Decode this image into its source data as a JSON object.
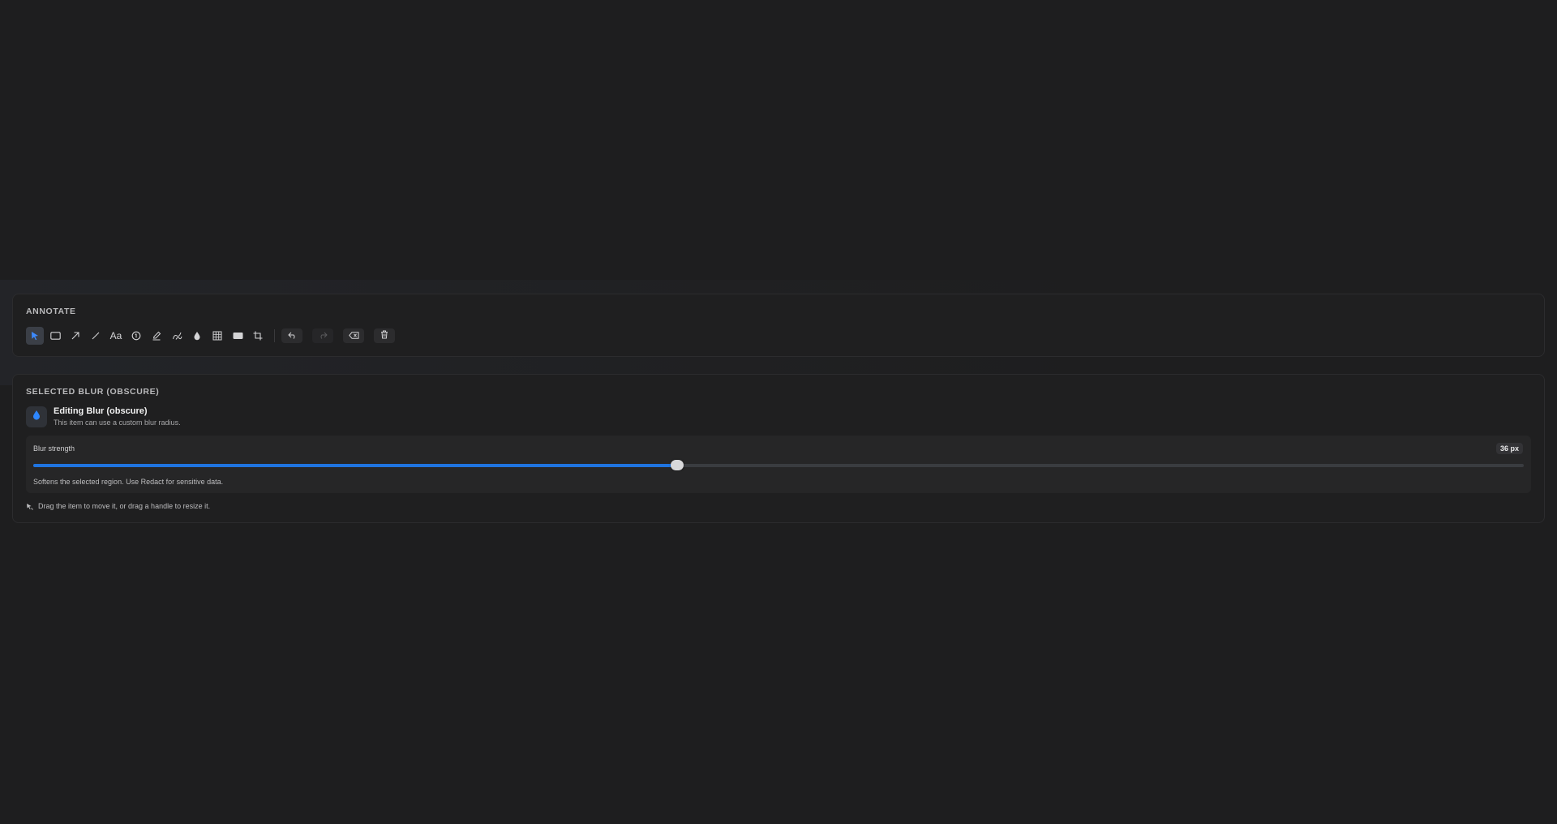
{
  "annotate": {
    "title": "ANNOTATE",
    "tools": [
      {
        "name": "select-tool",
        "icon": "cursor-icon",
        "active": true
      },
      {
        "name": "rectangle-tool",
        "icon": "rectangle-icon",
        "active": false
      },
      {
        "name": "arrow-tool",
        "icon": "arrow-icon",
        "active": false
      },
      {
        "name": "line-tool",
        "icon": "line-icon",
        "active": false
      },
      {
        "name": "text-tool",
        "icon": "text-icon",
        "label": "Aa",
        "active": false
      },
      {
        "name": "number-tool",
        "icon": "numbered-marker-icon",
        "active": false
      },
      {
        "name": "highlighter-tool",
        "icon": "highlighter-icon",
        "active": false
      },
      {
        "name": "pen-tool",
        "icon": "pen-icon",
        "active": false
      },
      {
        "name": "blur-tool",
        "icon": "droplet-icon",
        "active": false
      },
      {
        "name": "pixelate-tool",
        "icon": "grid-icon",
        "active": false
      },
      {
        "name": "redact-tool",
        "icon": "filled-rect-icon",
        "active": false
      },
      {
        "name": "crop-tool",
        "icon": "crop-icon",
        "active": false
      }
    ],
    "actions": [
      {
        "name": "undo-button",
        "icon": "undo-icon",
        "enabled": true
      },
      {
        "name": "redo-button",
        "icon": "redo-icon",
        "enabled": false
      },
      {
        "name": "erase-button",
        "icon": "backspace-icon",
        "enabled": true
      },
      {
        "name": "delete-button",
        "icon": "trash-icon",
        "enabled": true
      }
    ]
  },
  "selected": {
    "title": "SELECTED BLUR (OBSCURE)",
    "icon": "droplet-icon",
    "item_title": "Editing Blur (obscure)",
    "item_subtitle": "This item can use a custom blur radius.",
    "slider": {
      "label": "Blur strength",
      "value_text": "36 px",
      "fill_fraction": 0.432,
      "hint": "Softens the selected region. Use Redact for sensitive data."
    },
    "footer_hint": "Drag the item to move it, or drag a handle to resize it."
  },
  "colors": {
    "accent": "#1f74e0",
    "background": "#1e1e1f"
  }
}
